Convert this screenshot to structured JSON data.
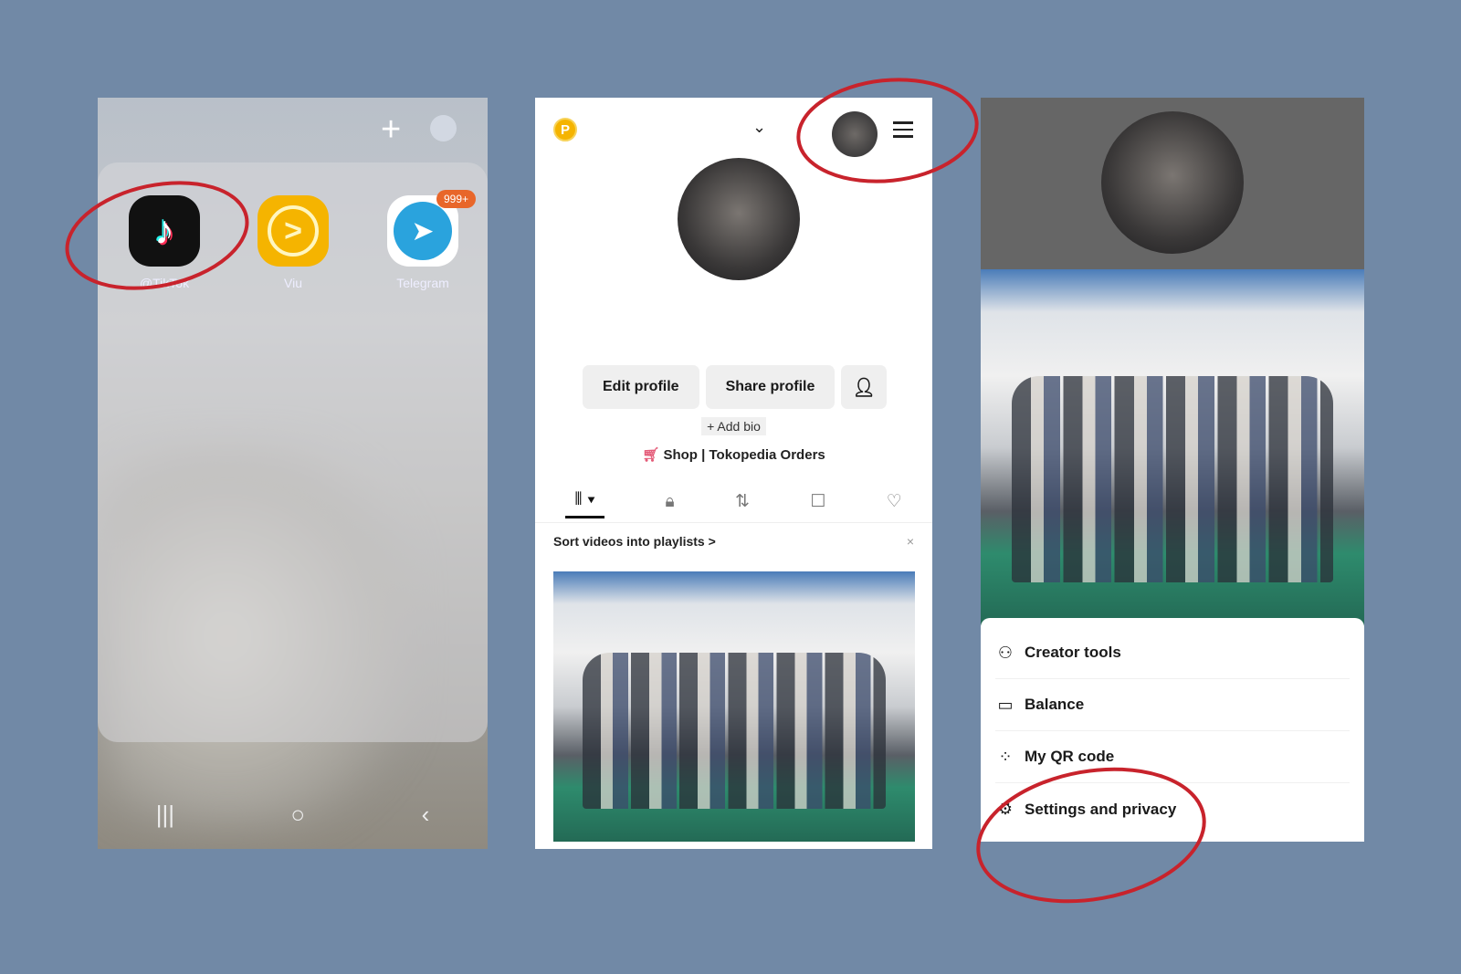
{
  "launcher": {
    "apps": [
      {
        "name": "TikTok",
        "label": "@TikTok"
      },
      {
        "name": "Viu",
        "label": "Viu"
      },
      {
        "name": "Telegram",
        "label": "Telegram",
        "badge": "999+"
      }
    ],
    "add_icon": "plus-icon",
    "nav": [
      "|||",
      "○",
      "‹"
    ]
  },
  "profile": {
    "coin_badge": "P",
    "edit_label": "Edit profile",
    "share_label": "Share profile",
    "add_bio": "+ Add bio",
    "shop": "Shop | Tokopedia Orders",
    "sort_banner": "Sort videos into playlists >",
    "close": "×",
    "tabs": [
      "videos",
      "private",
      "reposts",
      "favorites",
      "liked"
    ]
  },
  "menu": {
    "items": [
      {
        "icon": "creator-tools-icon",
        "label": "Creator tools"
      },
      {
        "icon": "wallet-icon",
        "label": "Balance"
      },
      {
        "icon": "qr-code-icon",
        "label": "My QR code"
      },
      {
        "icon": "gear-icon",
        "label": "Settings and privacy"
      }
    ]
  },
  "colors": {
    "background": "#7189a6",
    "annotation": "#c8232c",
    "tiktok": "#111111",
    "viu": "#f5b400",
    "telegram": "#2aa3dd"
  }
}
